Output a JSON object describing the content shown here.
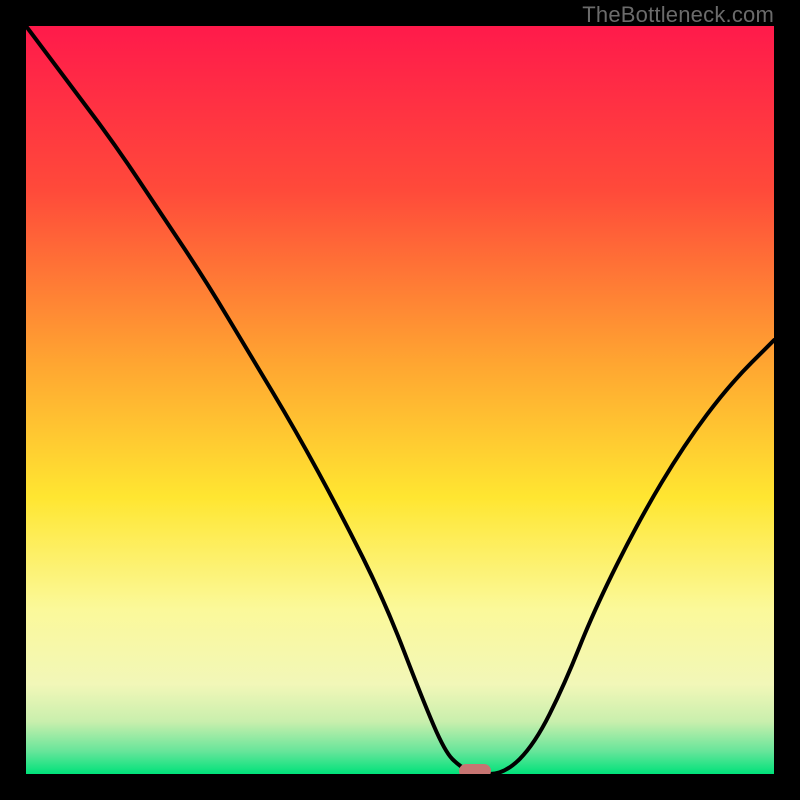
{
  "watermark": "TheBottleneck.com",
  "chart_data": {
    "type": "line",
    "title": "",
    "xlabel": "",
    "ylabel": "",
    "xlim": [
      0,
      100
    ],
    "ylim": [
      0,
      100
    ],
    "grid": false,
    "legend": false,
    "gradient_stops": [
      {
        "pos": 0,
        "color": "#ff1a4b"
      },
      {
        "pos": 22,
        "color": "#ff4a3a"
      },
      {
        "pos": 45,
        "color": "#ffa531"
      },
      {
        "pos": 63,
        "color": "#ffe631"
      },
      {
        "pos": 78,
        "color": "#fbf99a"
      },
      {
        "pos": 88,
        "color": "#f2f7b8"
      },
      {
        "pos": 93,
        "color": "#c9efad"
      },
      {
        "pos": 97,
        "color": "#66e59a"
      },
      {
        "pos": 100,
        "color": "#00e27a"
      }
    ],
    "series": [
      {
        "name": "bottleneck-curve",
        "x": [
          0,
          6,
          12,
          18,
          24,
          30,
          36,
          42,
          48,
          53,
          56,
          58,
          60,
          64,
          68,
          72,
          76,
          82,
          88,
          94,
          100
        ],
        "y": [
          100,
          92,
          84,
          75,
          66,
          56,
          46,
          35,
          23,
          10,
          3,
          1,
          0,
          0,
          4,
          12,
          22,
          34,
          44,
          52,
          58
        ]
      }
    ],
    "marker": {
      "x": 60,
      "y": 0,
      "color": "#c77572"
    }
  }
}
